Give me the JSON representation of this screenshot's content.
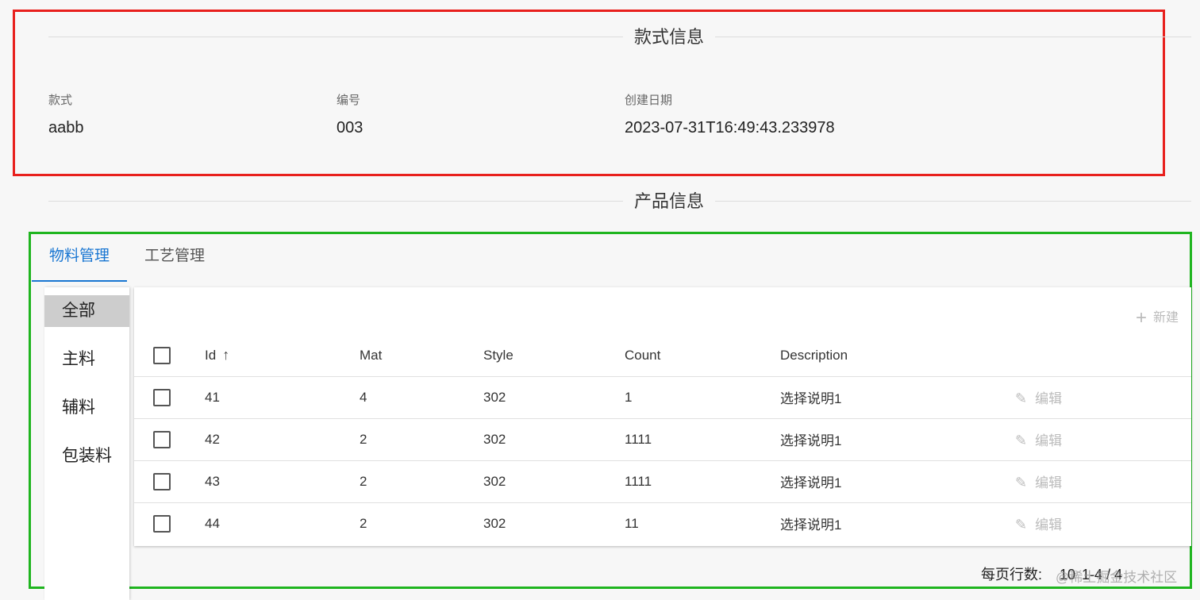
{
  "style_section": {
    "title": "款式信息",
    "fields": [
      {
        "label": "款式",
        "value": "aabb"
      },
      {
        "label": "编号",
        "value": "003"
      },
      {
        "label": "创建日期",
        "value": "2023-07-31T16:49:43.233978"
      }
    ]
  },
  "product_section": {
    "title": "产品信息",
    "tabs": [
      {
        "label": "物料管理",
        "active": true
      },
      {
        "label": "工艺管理",
        "active": false
      }
    ],
    "categories": [
      {
        "label": "全部",
        "active": true
      },
      {
        "label": "主料",
        "active": false
      },
      {
        "label": "辅料",
        "active": false
      },
      {
        "label": "包装料",
        "active": false
      }
    ],
    "new_button": {
      "icon": "plus-icon",
      "label": "新建"
    },
    "table": {
      "columns": [
        "Id",
        "Mat",
        "Style",
        "Count",
        "Description"
      ],
      "sort_icon": "arrow-up-icon",
      "rows": [
        {
          "id": "41",
          "mat": "4",
          "style": "302",
          "count": "1",
          "description": "选择说明1",
          "action": "编辑"
        },
        {
          "id": "42",
          "mat": "2",
          "style": "302",
          "count": "1111",
          "description": "选择说明1",
          "action": "编辑"
        },
        {
          "id": "43",
          "mat": "2",
          "style": "302",
          "count": "1111",
          "description": "选择说明1",
          "action": "编辑"
        },
        {
          "id": "44",
          "mat": "2",
          "style": "302",
          "count": "11",
          "description": "选择说明1",
          "action": "编辑"
        }
      ]
    },
    "pagination": {
      "rows_label": "每页行数:",
      "rows_per_page": "10",
      "range": "1-4 / 4"
    }
  },
  "watermark": "@稀土掘金技术社区",
  "colors": {
    "accent": "#1976d2",
    "annotation_red": "#e8201d",
    "annotation_green": "#1fb51f"
  }
}
